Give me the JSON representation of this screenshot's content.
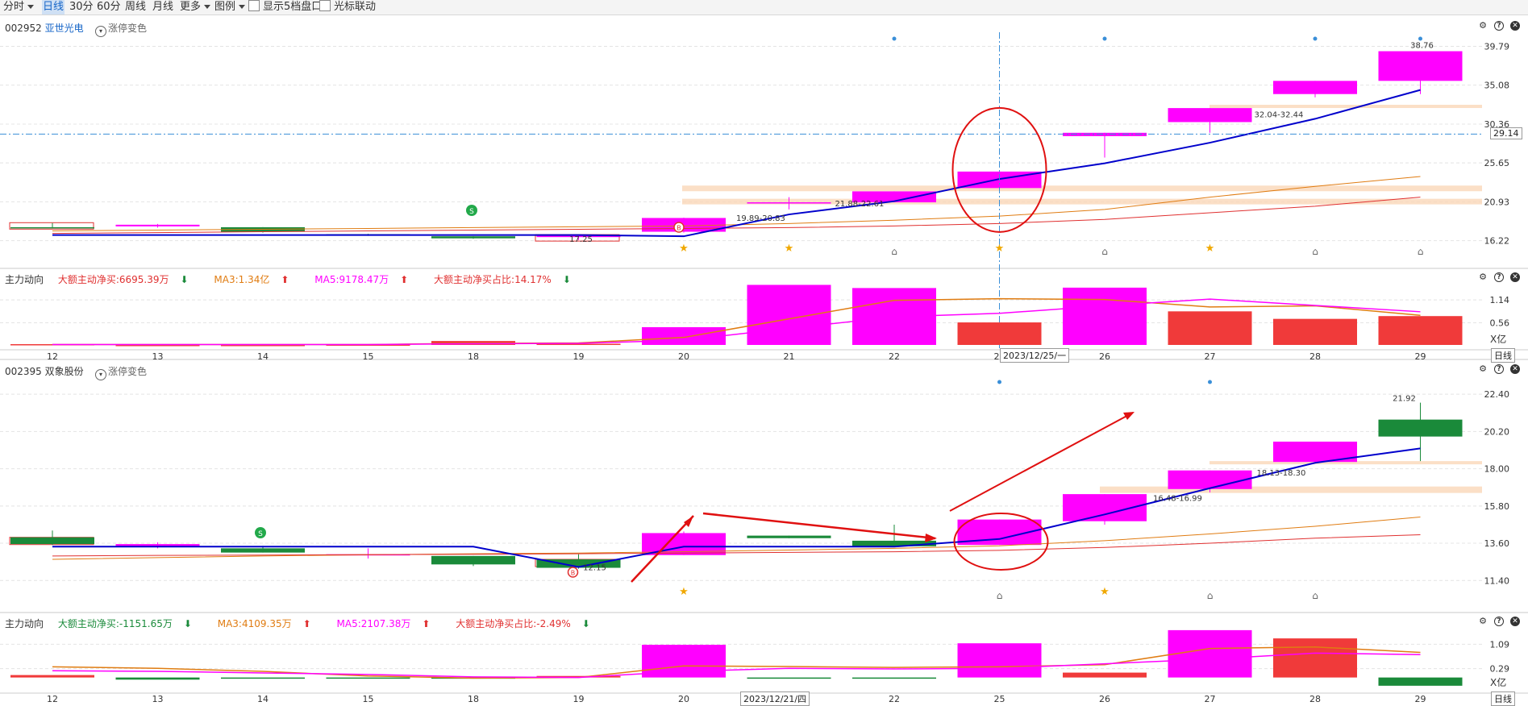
{
  "toolbar": {
    "items": [
      "分时",
      "日线",
      "30分",
      "60分",
      "周线",
      "月线",
      "更多",
      "图例"
    ],
    "active": "日线",
    "checkboxes": [
      "显示5档盘口",
      "光标联动"
    ]
  },
  "common": {
    "limit_color_label": "涨停变色",
    "flow_title": "主力动向",
    "period_label": "日线",
    "unit_label": "X亿"
  },
  "x_labels": [
    "12",
    "13",
    "14",
    "15",
    "18",
    "19",
    "20",
    "21",
    "22",
    "25",
    "26",
    "27",
    "28",
    "29"
  ],
  "colors": {
    "up": "#ff00ff",
    "down": "#1a8a3a",
    "ma_blue": "#0000cc",
    "ma_orange": "#e07c12",
    "ma_red": "#e03030",
    "bar_red": "#f03a3a",
    "band": "#fad7b8"
  },
  "panel1": {
    "code": "002952",
    "name": "亚世光电",
    "cursor_date": "2023/12/25/一",
    "cursor_price": "29.14",
    "flow": {
      "net": "大额主动净买:6695.39万",
      "ma3": "MA3:1.34亿",
      "ma5": "MA5:9178.47万",
      "ratio": "大额主动净买占比:14.17%"
    },
    "annotations": {
      "low": "17.25",
      "zone20": "19.89-20.83",
      "zone22": "21.88-22.61",
      "zone27": "32.04-32.44",
      "high": "38.76"
    }
  },
  "panel2": {
    "code": "002395",
    "name": "双象股份",
    "cursor_date": "2023/12/21/四",
    "flow": {
      "net": "大额主动净买:-1151.65万",
      "ma3": "MA3:4109.35万",
      "ma5": "MA5:2107.38万",
      "ratio": "大额主动净买占比:-2.49%"
    },
    "annotations": {
      "low": "12.15",
      "zone26": "16.48-16.99",
      "zone27": "18.13-18.30",
      "high": "21.92"
    }
  },
  "chart_data": [
    {
      "type": "candlestick",
      "title": "002952 亚世光电",
      "categories": [
        "12",
        "13",
        "14",
        "15",
        "18",
        "19",
        "20",
        "21",
        "22",
        "25",
        "26",
        "27",
        "28",
        "29"
      ],
      "y_ticks": [
        16.22,
        20.93,
        25.65,
        30.36,
        35.08,
        39.79
      ],
      "ylim": [
        15.3,
        41.5
      ],
      "ohlc": [
        [
          17.85,
          18.35,
          17.7,
          17.75
        ],
        [
          17.95,
          18.25,
          17.8,
          18.15
        ],
        [
          17.85,
          17.85,
          17.2,
          17.3
        ],
        [
          17.0,
          17.05,
          16.8,
          16.85
        ],
        [
          16.75,
          16.75,
          16.45,
          16.5
        ],
        [
          16.65,
          16.95,
          16.3,
          16.9
        ],
        [
          17.3,
          19.0,
          17.2,
          18.97
        ],
        [
          20.87,
          21.5,
          20.0,
          20.87
        ],
        [
          20.87,
          22.2,
          20.87,
          22.2
        ],
        [
          22.6,
          24.6,
          22.6,
          24.6
        ],
        [
          28.9,
          29.3,
          26.3,
          29.3
        ],
        [
          30.6,
          32.3,
          29.3,
          32.3
        ],
        [
          34.0,
          35.6,
          33.6,
          35.6
        ],
        [
          35.6,
          39.2,
          34.0,
          39.2
        ]
      ],
      "ma_blue": [
        16.9,
        16.9,
        16.9,
        16.9,
        16.9,
        16.9,
        16.75,
        19.4,
        21.0,
        23.7,
        25.6,
        28.1,
        31.0,
        34.5
      ],
      "ma_orange": [
        17.4,
        17.5,
        17.6,
        17.7,
        17.8,
        17.9,
        18.0,
        18.3,
        18.7,
        19.2,
        20.0,
        21.5,
        22.8,
        24.0
      ],
      "ma_red": [
        17.1,
        17.2,
        17.3,
        17.4,
        17.5,
        17.6,
        17.7,
        17.8,
        18.0,
        18.3,
        18.8,
        19.6,
        20.4,
        21.5
      ]
    },
    {
      "type": "bar",
      "title": "主力动向",
      "categories": [
        "12",
        "13",
        "14",
        "15",
        "18",
        "19",
        "20",
        "21",
        "22",
        "25",
        "26",
        "27",
        "28",
        "29"
      ],
      "y_ticks": [
        0.56,
        1.14
      ],
      "ylim": [
        0,
        1.55
      ],
      "values": [
        0.02,
        0.0,
        0.0,
        0.01,
        0.1,
        0.03,
        0.45,
        1.52,
        1.44,
        0.57,
        1.45,
        0.85,
        0.66,
        0.73
      ],
      "kind": [
        "net",
        "net",
        "net",
        "net",
        "net",
        "net",
        "big",
        "big",
        "big",
        "net",
        "big",
        "net",
        "net",
        "net"
      ],
      "ma3": [
        0.01,
        0.01,
        0.01,
        0.01,
        0.04,
        0.05,
        0.19,
        0.66,
        1.13,
        1.17,
        1.15,
        0.96,
        0.99,
        0.75
      ],
      "ma5": [
        0.01,
        0.01,
        0.01,
        0.01,
        0.03,
        0.04,
        0.12,
        0.42,
        0.71,
        0.8,
        0.99,
        1.16,
        1.0,
        0.84
      ]
    },
    {
      "type": "candlestick",
      "title": "002395 双象股份",
      "categories": [
        "12",
        "13",
        "14",
        "15",
        "18",
        "19",
        "20",
        "21",
        "22",
        "25",
        "26",
        "27",
        "28",
        "29"
      ],
      "y_ticks": [
        11.4,
        13.6,
        15.8,
        18.0,
        20.2,
        22.4
      ],
      "ylim": [
        10.7,
        23.5
      ],
      "ohlc": [
        [
          13.95,
          14.35,
          13.5,
          13.55
        ],
        [
          13.4,
          13.65,
          13.3,
          13.55
        ],
        [
          13.3,
          13.45,
          13.05,
          13.05
        ],
        [
          12.95,
          13.3,
          12.7,
          12.95
        ],
        [
          12.85,
          12.85,
          12.25,
          12.35
        ],
        [
          12.65,
          12.95,
          12.1,
          12.15
        ],
        [
          12.9,
          14.3,
          12.9,
          14.2
        ],
        [
          14.05,
          14.05,
          13.9,
          13.9
        ],
        [
          13.75,
          14.7,
          13.4,
          13.42
        ],
        [
          13.5,
          15.0,
          13.5,
          15.0
        ],
        [
          14.9,
          16.5,
          14.7,
          16.5
        ],
        [
          16.8,
          17.9,
          16.6,
          17.9
        ],
        [
          18.4,
          19.6,
          18.4,
          19.6
        ],
        [
          20.9,
          21.9,
          18.45,
          19.9
        ]
      ],
      "ma_blue": [
        13.4,
        13.4,
        13.4,
        13.4,
        13.4,
        12.2,
        13.4,
        13.4,
        13.4,
        13.85,
        15.3,
        16.85,
        18.35,
        19.2
      ],
      "ma_orange": [
        12.65,
        12.75,
        12.85,
        12.92,
        12.98,
        13.02,
        13.1,
        13.2,
        13.3,
        13.45,
        13.75,
        14.15,
        14.6,
        15.15
      ],
      "ma_red": [
        12.85,
        12.88,
        12.9,
        12.93,
        12.95,
        12.98,
        13.02,
        13.06,
        13.1,
        13.18,
        13.35,
        13.6,
        13.9,
        14.1
      ]
    },
    {
      "type": "bar",
      "title": "主力动向",
      "categories": [
        "12",
        "13",
        "14",
        "15",
        "18",
        "19",
        "20",
        "21",
        "22",
        "25",
        "26",
        "27",
        "28",
        "29"
      ],
      "y_ticks": [
        0.29,
        1.09
      ],
      "ylim": [
        -0.3,
        1.6
      ],
      "values": [
        0.08,
        -0.07,
        -0.04,
        -0.03,
        -0.02,
        0.05,
        1.07,
        -0.04,
        -0.04,
        1.12,
        0.16,
        1.55,
        1.28,
        -0.27
      ],
      "kind": [
        "net",
        "net",
        "net",
        "net",
        "net",
        "net",
        "big",
        "net",
        "net",
        "big",
        "net",
        "big",
        "net",
        "net"
      ],
      "ma3": [
        0.35,
        0.3,
        0.2,
        0.05,
        -0.02,
        0.0,
        0.38,
        0.36,
        0.33,
        0.35,
        0.42,
        0.95,
        1.0,
        0.82
      ],
      "ma5": [
        0.22,
        0.2,
        0.15,
        0.1,
        0.02,
        0.0,
        0.2,
        0.3,
        0.28,
        0.3,
        0.45,
        0.6,
        0.8,
        0.75
      ]
    }
  ]
}
